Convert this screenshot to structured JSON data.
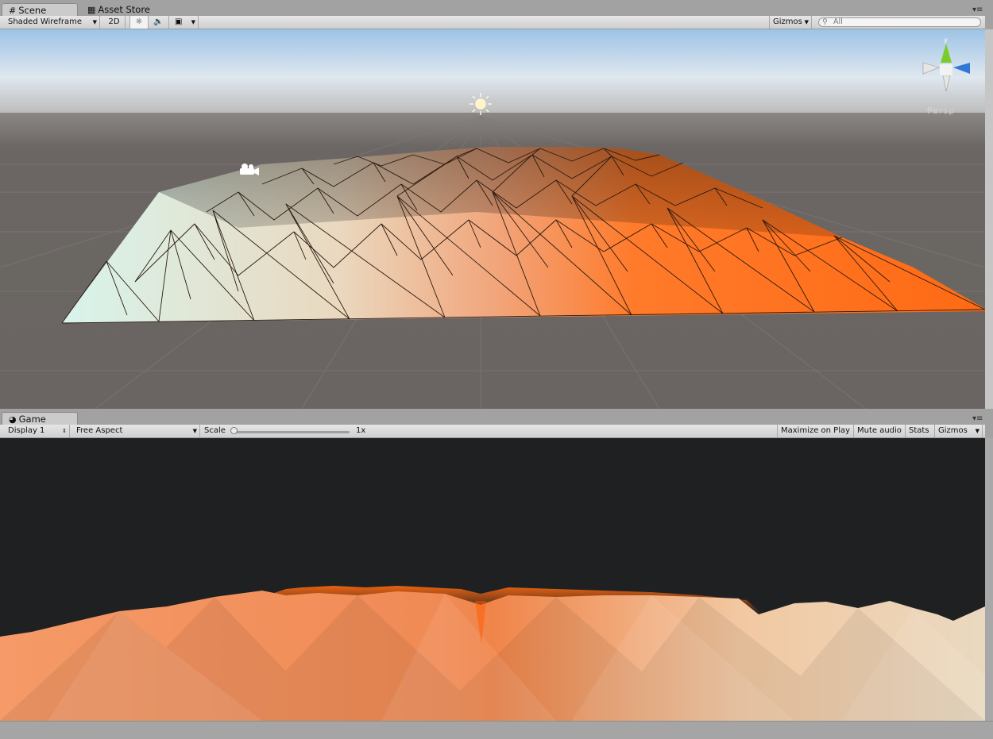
{
  "scene_window": {
    "tabs": [
      {
        "label": "Scene",
        "icon": "scene-grid-icon"
      },
      {
        "label": "Asset Store",
        "icon": "store-bag-icon"
      }
    ],
    "toolbar": {
      "draw_mode": "Shaded Wireframe",
      "mode_2d": "2D",
      "gizmos": "Gizmos",
      "search_placeholder": "All"
    },
    "view_label": "Persp"
  },
  "game_window": {
    "tab": {
      "label": "Game",
      "icon": "game-pacman-icon"
    },
    "toolbar": {
      "display": "Display 1",
      "aspect": "Free Aspect",
      "scale_label": "Scale",
      "scale_value": "1x",
      "maximize": "Maximize on Play",
      "mute": "Mute audio",
      "stats": "Stats",
      "gizmos": "Gizmos"
    }
  },
  "colors": {
    "editor_bg": "#a2a2a2",
    "sky_top": "#9ec3e6",
    "ground": "#6b6663",
    "terrain_light": "#d8f4ec",
    "terrain_dark": "#ff6a14",
    "game_bg": "#1f2022"
  }
}
